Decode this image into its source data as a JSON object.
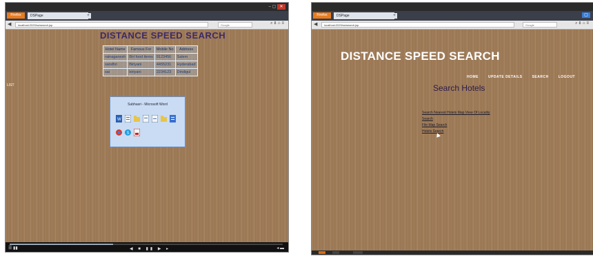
{
  "left": {
    "app_button": "Firefox",
    "tab_title": "DSPage",
    "url": "localhost:2020/ss/search.jsp",
    "search_placeholder": "Google",
    "page_title": "DISTANCE SPEED SEARCH",
    "table": {
      "headers": [
        "Hotel Name",
        "Famous For",
        "Mobile No",
        "Address"
      ],
      "rows": [
        [
          "rainaganesh",
          "BH food items",
          "9123456",
          "Salem"
        ],
        [
          "sandhri",
          "Biriyani",
          "4455231",
          "Hyderabad"
        ],
        [
          "sai",
          "biriyani",
          "2234123",
          "Dindigul"
        ]
      ]
    },
    "side_text": "LIST",
    "popup": {
      "title": "Subhasri - Microsoft Word",
      "icons_row1": [
        "word-icon",
        "doc-icon",
        "folder-icon",
        "doc-icon",
        "doc-icon",
        "folder-icon",
        "list-icon"
      ],
      "icons_row2": [
        "chrome-icon",
        "skype-icon",
        "pdf-icon"
      ]
    },
    "progress_fraction": 0.38
  },
  "right": {
    "app_button": "Firefox",
    "tab_title": "DSPage",
    "url": "localhost:2020/ss/search.jsp",
    "search_placeholder": "Google",
    "brand": "DISTANCE SPEED SEARCH",
    "nav": [
      "HOME",
      "UPDATE DETAILS",
      "SEARCH",
      "LOGOUT"
    ],
    "heading": "Search Hotels",
    "links": [
      "Search Nearest Hotels Map View Of Locality",
      "Search",
      "File Map Search",
      "Hotels Search"
    ]
  },
  "colors": {
    "wood": "#a07c58",
    "title_purple": "#3b2a6a",
    "firefox_orange": "#e87b1e"
  }
}
